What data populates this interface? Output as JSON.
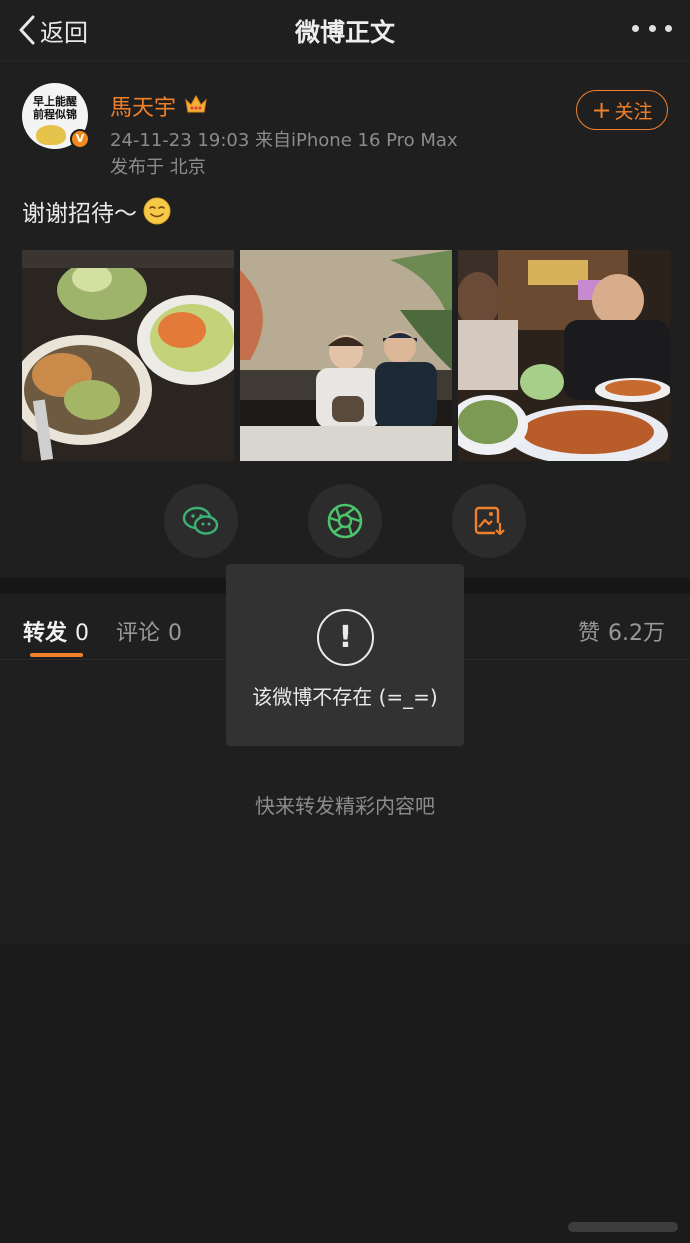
{
  "nav": {
    "back_label": "返回",
    "title": "微博正文"
  },
  "post": {
    "avatar_text": "早上能醒\n前程似锦",
    "verified_mark": "V",
    "username": "馬天宇",
    "timestamp_source": "24-11-23 19:03  来自iPhone 16 Pro Max",
    "location": "发布于 北京",
    "follow_label": "关注",
    "text": "谢谢招待～"
  },
  "share": {
    "items": [
      "wechat-icon",
      "moments-icon",
      "save-image-icon"
    ]
  },
  "tabs": {
    "repost_label": "转发",
    "repost_count": "0",
    "comment_label": "评论",
    "comment_count": "0",
    "like_label": "赞",
    "like_count": "6.2万"
  },
  "empty_hint": "快来转发精彩内容吧",
  "toast": {
    "icon": "!",
    "message": "该微博不存在 (=_=)"
  },
  "colors": {
    "accent": "#f2802b",
    "background": "#1b1b1b",
    "surface": "#1f1f1f",
    "wechat_green": "#3bb273"
  }
}
